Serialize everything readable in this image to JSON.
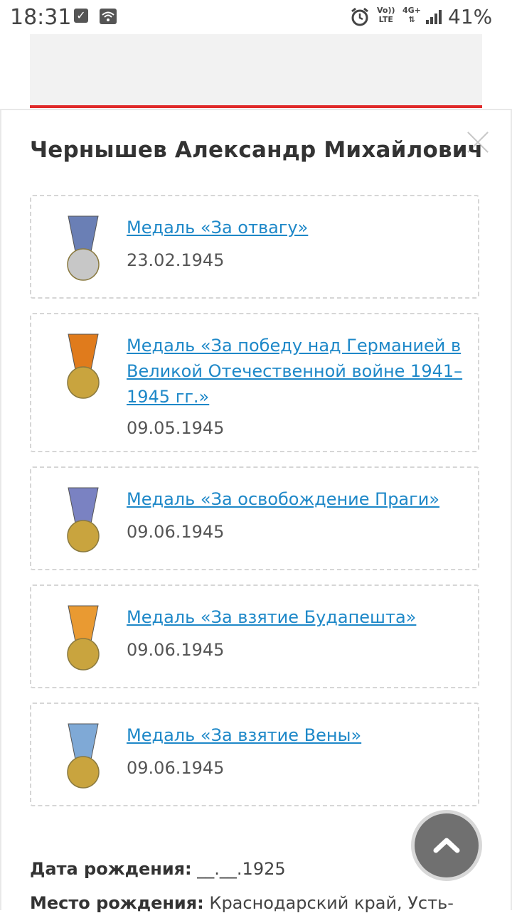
{
  "status_bar": {
    "time": "18:31",
    "battery": "41%",
    "volte_top": "Vo))",
    "volte_bottom": "LTE",
    "network_top": "4G+",
    "network_bottom": "⇅"
  },
  "person": {
    "name": "Чернышев Александр Михайлович"
  },
  "awards": [
    {
      "title": "Медаль «За отвагу»",
      "date": "23.02.1945",
      "ribbon": "#6a7fb5",
      "medal": "#c7c7c7"
    },
    {
      "title": "Медаль «За победу над Германией в Великой Отечественной войне 1941–1945 гг.»",
      "date": "09.05.1945",
      "ribbon": "#e07b1c",
      "medal": "#c9a43e"
    },
    {
      "title": "Медаль «За освобождение Праги»",
      "date": "09.06.1945",
      "ribbon": "#7a82c2",
      "medal": "#c9a43e"
    },
    {
      "title": "Медаль «За взятие Будапешта»",
      "date": "09.06.1945",
      "ribbon": "#e99a32",
      "medal": "#c9a43e"
    },
    {
      "title": "Медаль «За взятие Вены»",
      "date": "09.06.1945",
      "ribbon": "#7fa9d6",
      "medal": "#c9a43e"
    }
  ],
  "details": {
    "birth_date_label": "Дата рождения:",
    "birth_date_value": "__.__.1925",
    "birth_place_label": "Место рождения:",
    "birth_place_value": "Краснодарский край, Усть-"
  },
  "icons": {
    "close": "close-icon",
    "scroll_top": "chevron-up-icon"
  }
}
